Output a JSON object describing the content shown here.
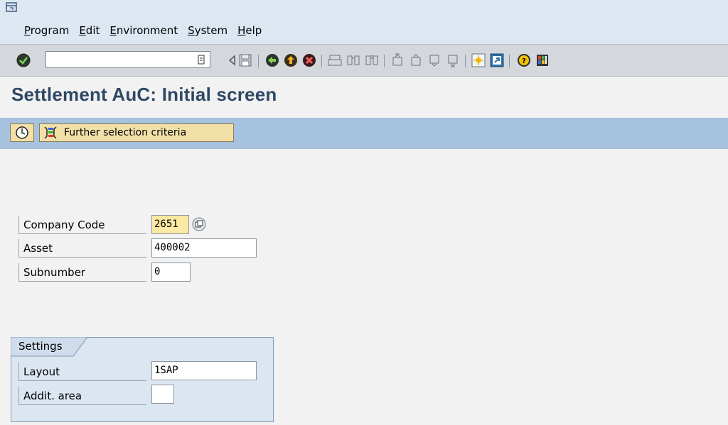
{
  "menu": {
    "items": [
      "Program",
      "Edit",
      "Environment",
      "System",
      "Help"
    ]
  },
  "toolbar": {
    "command_value": "",
    "icons": [
      "enter-icon",
      "back-icon",
      "exit-icon",
      "cancel-icon",
      "print-icon",
      "find-icon",
      "find-next-icon",
      "first-page-icon",
      "previous-page-icon",
      "next-page-icon",
      "last-page-icon",
      "create-session-icon",
      "shortcut-icon",
      "help-icon",
      "customize-layout-icon"
    ]
  },
  "page": {
    "title": "Settlement AuC: Initial screen"
  },
  "app_toolbar": {
    "further_label": "Further selection criteria"
  },
  "form": {
    "company_code": {
      "label": "Company Code",
      "value": "2651"
    },
    "asset": {
      "label": "Asset",
      "value": "400002"
    },
    "subnumber": {
      "label": "Subnumber",
      "value": "0"
    }
  },
  "settings": {
    "title": "Settings",
    "layout": {
      "label": "Layout",
      "value": "1SAP"
    },
    "addit_area": {
      "label": "Addit. area",
      "value": ""
    }
  },
  "colors": {
    "title": "#2f4864",
    "app_toolbar_bg": "#a7c2de",
    "required_field_bg": "#fde9a3",
    "button_bg": "#f3e0a8"
  }
}
